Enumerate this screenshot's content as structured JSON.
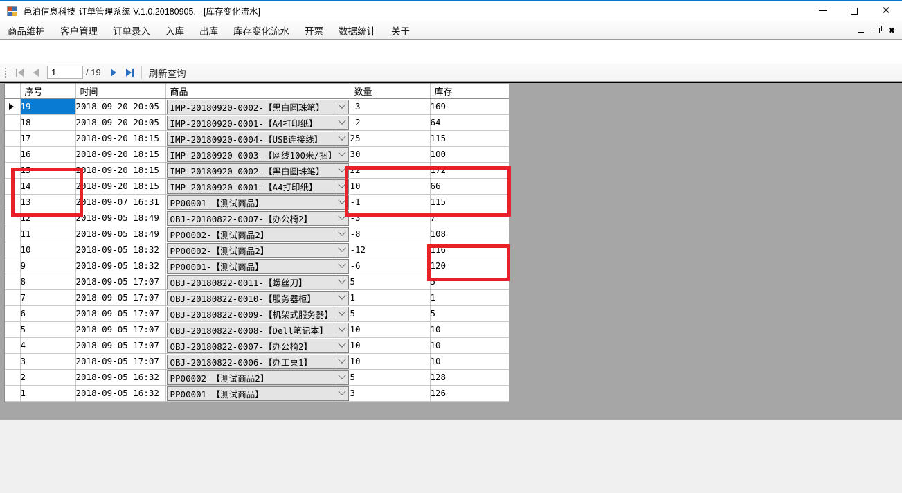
{
  "window": {
    "title": "邑泊信息科技-订单管理系统-V.1.0.20180905. - [库存变化流水]",
    "icon": "app-icon",
    "minimize_label": "—",
    "maximize_label": "□",
    "close_label": "✕"
  },
  "mdi_controls": {
    "minimize_label": "_",
    "restore_label": "❐",
    "close_label": "✖"
  },
  "menu": {
    "items": [
      {
        "label": "商品维护"
      },
      {
        "label": "客户管理"
      },
      {
        "label": "订单录入"
      },
      {
        "label": "入库"
      },
      {
        "label": "出库"
      },
      {
        "label": "库存变化流水"
      },
      {
        "label": "开票"
      },
      {
        "label": "数据统计"
      },
      {
        "label": "关于"
      }
    ]
  },
  "toolbar": {
    "first_label": "first-page",
    "prev_label": "previous-page",
    "page_value": "1",
    "page_total": "/ 19",
    "next_label": "next-page",
    "last_label": "last-page",
    "refresh_label": "刷新查询"
  },
  "grid": {
    "columns": [
      {
        "key": "selector",
        "label": ""
      },
      {
        "key": "index",
        "label": "序号"
      },
      {
        "key": "time",
        "label": "时间"
      },
      {
        "key": "product",
        "label": "商品"
      },
      {
        "key": "quantity",
        "label": "数量"
      },
      {
        "key": "stock",
        "label": "库存"
      }
    ],
    "selected_row_index": 0,
    "rows": [
      {
        "index": "19",
        "time": "2018-09-20 20:05",
        "product": "IMP-20180920-0002-【黑白圆珠笔】",
        "quantity": "-3",
        "stock": "169"
      },
      {
        "index": "18",
        "time": "2018-09-20 20:05",
        "product": "IMP-20180920-0001-【A4打印纸】",
        "quantity": "-2",
        "stock": "64"
      },
      {
        "index": "17",
        "time": "2018-09-20 18:15",
        "product": "IMP-20180920-0004-【USB连接线】",
        "quantity": "25",
        "stock": "115"
      },
      {
        "index": "16",
        "time": "2018-09-20 18:15",
        "product": "IMP-20180920-0003-【网线100米/捆】",
        "quantity": "30",
        "stock": "100"
      },
      {
        "index": "15",
        "time": "2018-09-20 18:15",
        "product": "IMP-20180920-0002-【黑白圆珠笔】",
        "quantity": "22",
        "stock": "172"
      },
      {
        "index": "14",
        "time": "2018-09-20 18:15",
        "product": "IMP-20180920-0001-【A4打印纸】",
        "quantity": "10",
        "stock": "66"
      },
      {
        "index": "13",
        "time": "2018-09-07 16:31",
        "product": "PP00001-【测试商品】",
        "quantity": "-1",
        "stock": "115"
      },
      {
        "index": "12",
        "time": "2018-09-05 18:49",
        "product": "OBJ-20180822-0007-【办公椅2】",
        "quantity": "-3",
        "stock": "7"
      },
      {
        "index": "11",
        "time": "2018-09-05 18:49",
        "product": "PP00002-【测试商品2】",
        "quantity": "-8",
        "stock": "108"
      },
      {
        "index": "10",
        "time": "2018-09-05 18:32",
        "product": "PP00002-【测试商品2】",
        "quantity": "-12",
        "stock": "116"
      },
      {
        "index": "9",
        "time": "2018-09-05 18:32",
        "product": "PP00001-【测试商品】",
        "quantity": "-6",
        "stock": "120"
      },
      {
        "index": "8",
        "time": "2018-09-05 17:07",
        "product": "OBJ-20180822-0011-【螺丝刀】",
        "quantity": "5",
        "stock": "5"
      },
      {
        "index": "7",
        "time": "2018-09-05 17:07",
        "product": "OBJ-20180822-0010-【服务器柜】",
        "quantity": "1",
        "stock": "1"
      },
      {
        "index": "6",
        "time": "2018-09-05 17:07",
        "product": "OBJ-20180822-0009-【机架式服务器】",
        "quantity": "5",
        "stock": "5"
      },
      {
        "index": "5",
        "time": "2018-09-05 17:07",
        "product": "OBJ-20180822-0008-【Dell笔记本】",
        "quantity": "10",
        "stock": "10"
      },
      {
        "index": "4",
        "time": "2018-09-05 17:07",
        "product": "OBJ-20180822-0007-【办公椅2】",
        "quantity": "10",
        "stock": "10"
      },
      {
        "index": "3",
        "time": "2018-09-05 17:07",
        "product": "OBJ-20180822-0006-【办工桌1】",
        "quantity": "10",
        "stock": "10"
      },
      {
        "index": "2",
        "time": "2018-09-05 16:32",
        "product": "PP00002-【测试商品2】",
        "quantity": "5",
        "stock": "128"
      },
      {
        "index": "1",
        "time": "2018-09-05 16:32",
        "product": "PP00001-【测试商品】",
        "quantity": "3",
        "stock": "126"
      }
    ]
  },
  "annotations": {
    "color": "#e8202a",
    "boxes": [
      {
        "name": "index-column-highlight"
      },
      {
        "name": "quantity-stock-header-highlight"
      },
      {
        "name": "stock-values-highlight"
      }
    ]
  }
}
